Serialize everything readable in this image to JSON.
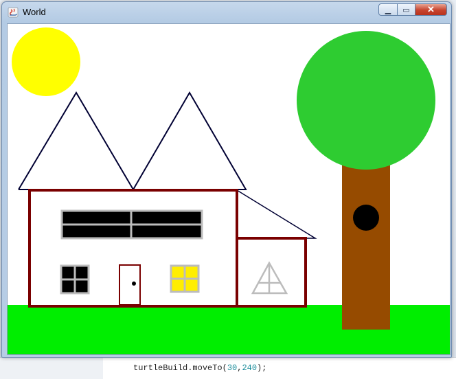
{
  "window": {
    "title": "World",
    "minimize_glyph": "▁",
    "maximize_glyph": "▭",
    "close_glyph": "✕"
  },
  "background_editor": {
    "code_line_prefix": "turtleBuild.moveTo(",
    "code_arg1": "30",
    "code_sep": ",",
    "code_arg2": "240",
    "code_suffix": ");"
  },
  "scene": {
    "colors": {
      "sky": "#ffffff",
      "grass": "#00ee00",
      "sun": "#ffff00",
      "tree_foliage": "#2ecc31",
      "tree_trunk": "#964b00",
      "knothole": "#000000",
      "house_outline": "#7a0000",
      "roof_outline": "#000033",
      "window_dark": "#000000",
      "window_frame": "#bcbcbc",
      "window_lit": "#ffee00",
      "door_outline": "#7a0000",
      "door_knob": "#000000"
    },
    "icons": [
      "java-icon",
      "sun",
      "tree",
      "house"
    ]
  }
}
